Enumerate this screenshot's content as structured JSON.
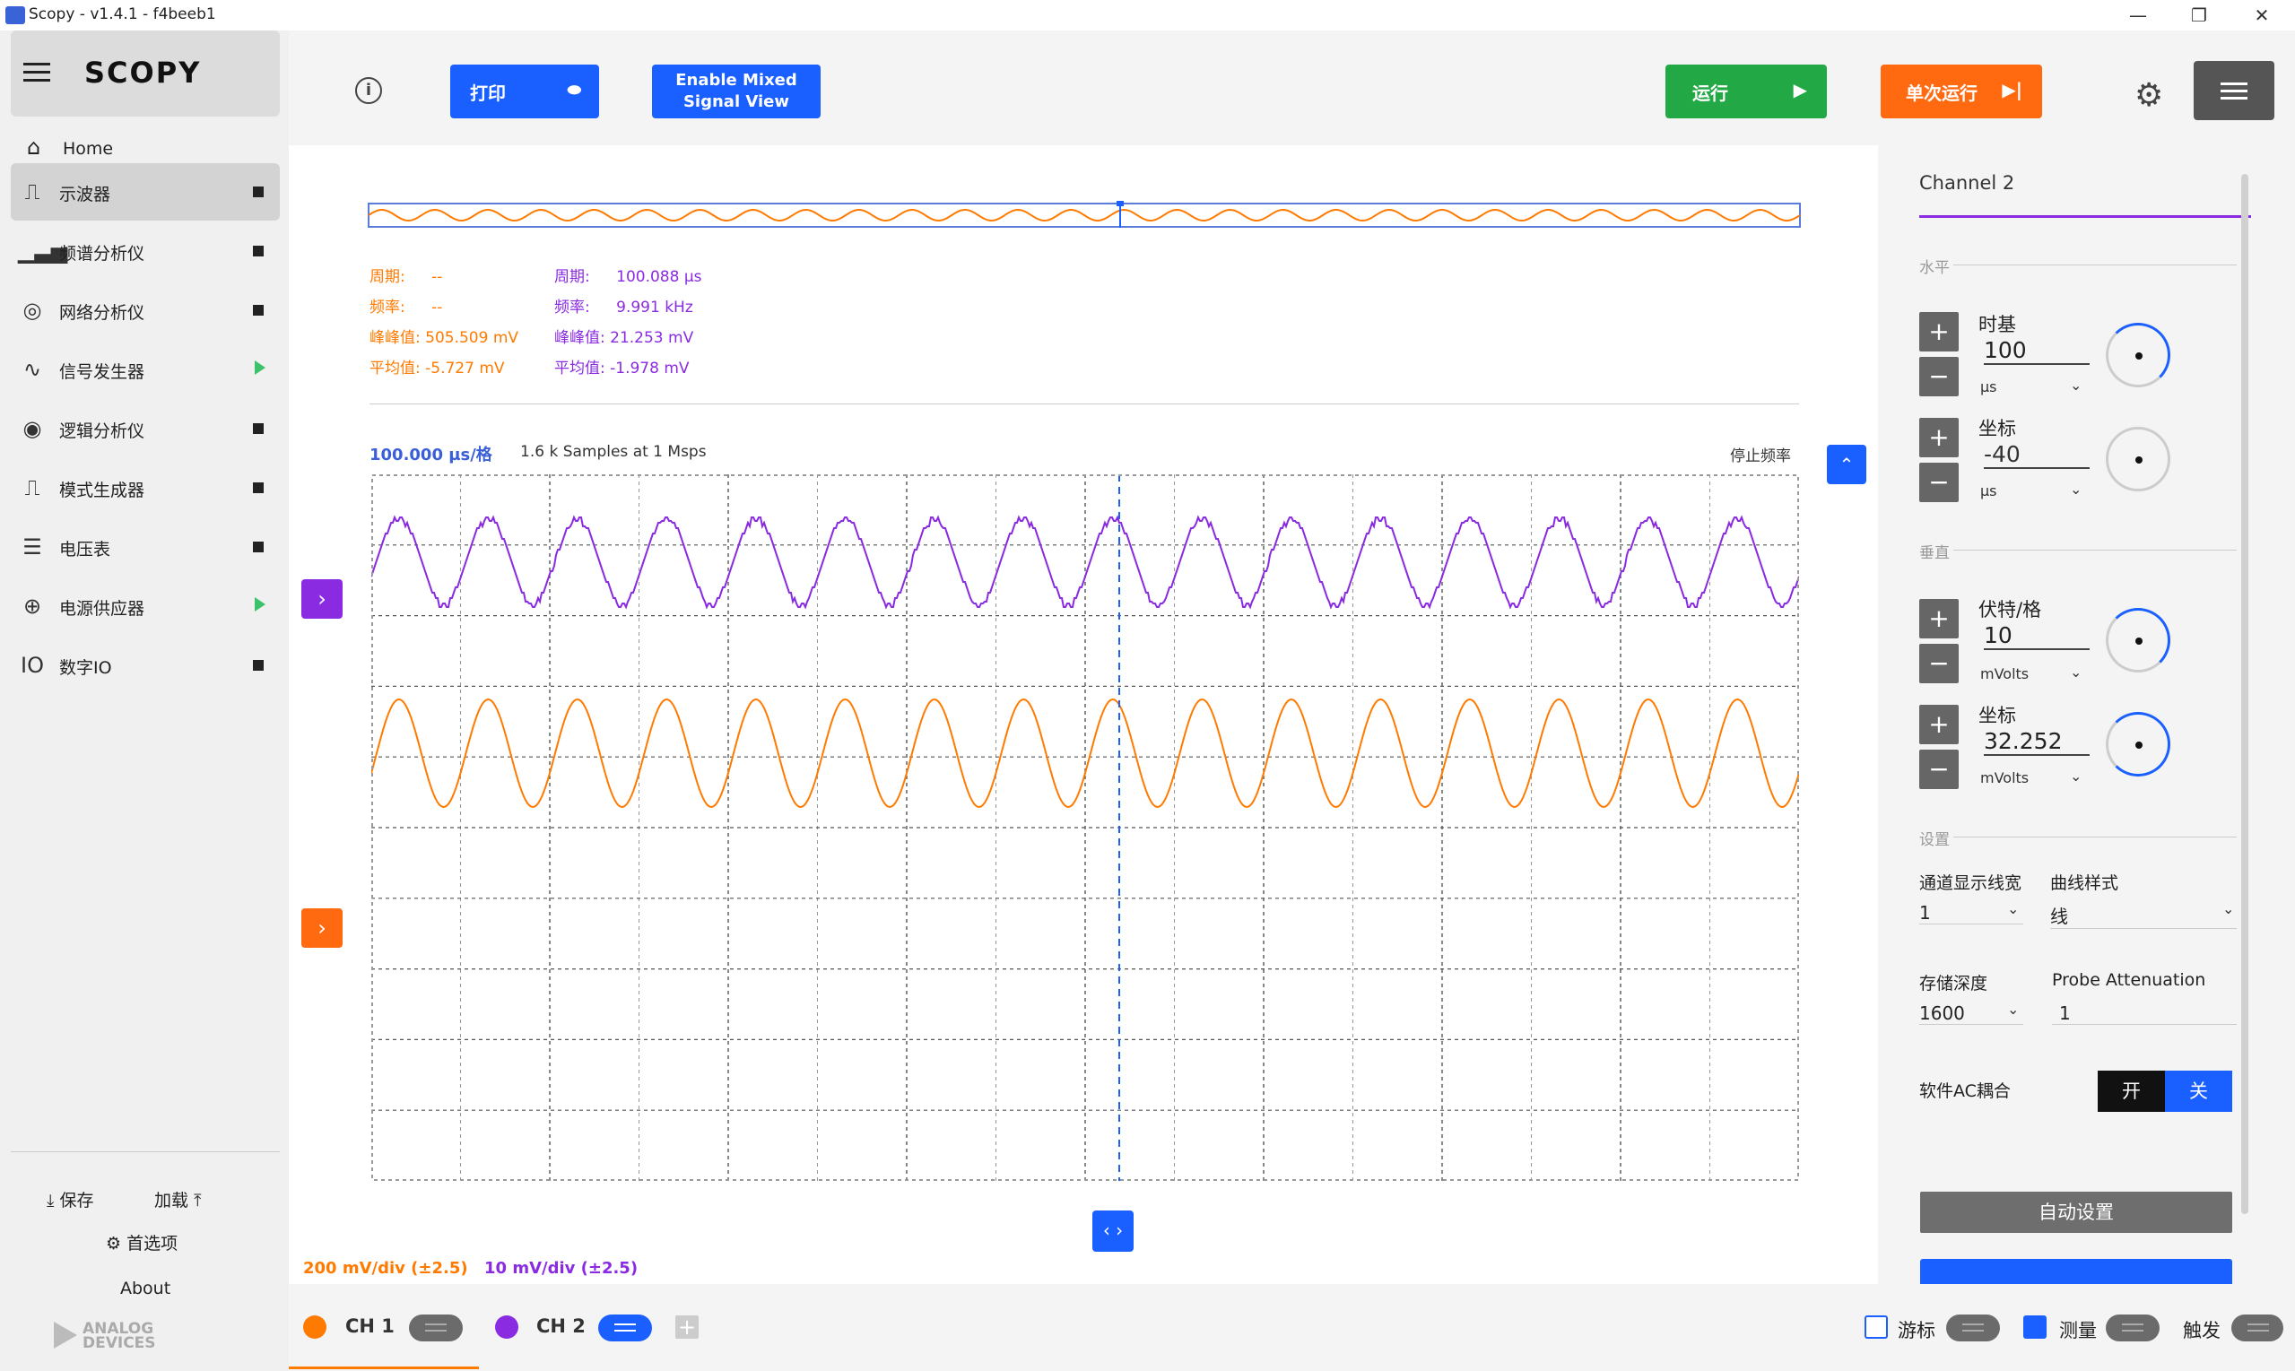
{
  "window": {
    "title": "Scopy - v1.4.1 - f4beeb1"
  },
  "sidebar": {
    "logo": "SCOPY",
    "home": "Home",
    "items": [
      {
        "label": "示波器",
        "icon": "oscilloscope-icon",
        "status": "stop",
        "active": true
      },
      {
        "label": "频谱分析仪",
        "icon": "spectrum-icon",
        "status": "stop"
      },
      {
        "label": "网络分析仪",
        "icon": "network-icon",
        "status": "stop"
      },
      {
        "label": "信号发生器",
        "icon": "signal-icon",
        "status": "running"
      },
      {
        "label": "逻辑分析仪",
        "icon": "logic-icon",
        "status": "stop"
      },
      {
        "label": "模式生成器",
        "icon": "pattern-icon",
        "status": "stop"
      },
      {
        "label": "电压表",
        "icon": "voltmeter-icon",
        "status": "stop"
      },
      {
        "label": "电源供应器",
        "icon": "power-icon",
        "status": "running"
      },
      {
        "label": "数字IO",
        "icon": "dio-icon",
        "status": "stop"
      }
    ],
    "save": "保存",
    "load": "加载",
    "preferences": "首选项",
    "about": "About",
    "brand_line1": "ANALOG",
    "brand_line2": "DEVICES"
  },
  "toolbar": {
    "print": "打印",
    "mixed_line1": "Enable Mixed",
    "mixed_line2": "Signal View",
    "run": "运行",
    "single": "单次运行"
  },
  "measurements": {
    "ch1": {
      "period_label": "周期:",
      "period": "--",
      "freq_label": "频率:",
      "freq": "--",
      "p2p_label": "峰峰值:",
      "p2p": "505.509 mV",
      "avg_label": "平均值:",
      "avg": "-5.727 mV"
    },
    "ch2": {
      "period_label": "周期:",
      "period": "100.088 µs",
      "freq_label": "频率:",
      "freq": "9.991 kHz",
      "p2p_label": "峰峰值:",
      "p2p": "21.253 mV",
      "avg_label": "平均值:",
      "avg": "-1.978 mV"
    }
  },
  "plot": {
    "timebase": "100.000 µs/格",
    "samples": "1.6 k Samples at 1 Msps",
    "stop_freq": "停止频率",
    "ch1_scale": "200 mV/div (±2.5)",
    "ch2_scale": "10 mV/div (±2.5)"
  },
  "colors": {
    "ch1": "#ff7a00",
    "ch2": "#8a2be2",
    "accent": "#1a5fff",
    "run": "#22a845",
    "single": "#ff6a10"
  },
  "right_panel": {
    "title": "Channel 2",
    "horizontal": "水平",
    "timebase_label": "时基",
    "timebase_value": "100",
    "timebase_unit": "µs",
    "hpos_label": "坐标",
    "hpos_value": "-40",
    "hpos_unit": "µs",
    "vertical": "垂直",
    "vdiv_label": "伏特/格",
    "vdiv_value": "10",
    "vdiv_unit": "mVolts",
    "vpos_label": "坐标",
    "vpos_value": "32.252",
    "vpos_unit": "mVolts",
    "settings": "设置",
    "thickness_label": "通道显示线宽",
    "thickness_value": "1",
    "style_label": "曲线样式",
    "style_value": "线",
    "memory_label": "存储深度",
    "memory_value": "1600",
    "probe_label": "Probe Attenuation",
    "probe_value": "1",
    "ac_label": "软件AC耦合",
    "ac_off": "开",
    "ac_on": "关",
    "autoset": "自动设置"
  },
  "bottom": {
    "ch1": "CH 1",
    "ch2": "CH 2",
    "cursor": "游标",
    "measure": "测量",
    "trigger": "触发"
  }
}
